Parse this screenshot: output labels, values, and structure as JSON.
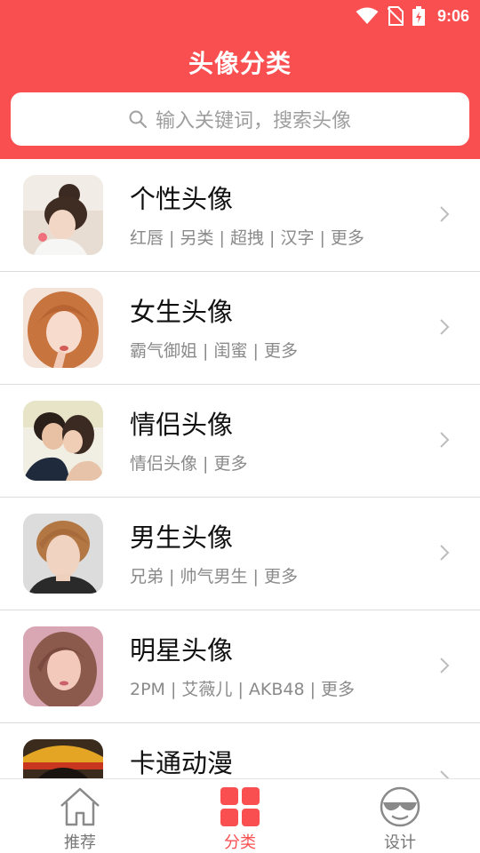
{
  "status": {
    "time": "9:06"
  },
  "header": {
    "title": "头像分类"
  },
  "search": {
    "placeholder": "输入关键词，搜索头像"
  },
  "categories": [
    {
      "title": "个性头像",
      "tags": "红唇 | 另类 | 超拽 | 汉字 | 更多"
    },
    {
      "title": "女生头像",
      "tags": "霸气御姐 | 闺蜜 | 更多"
    },
    {
      "title": "情侣头像",
      "tags": "情侣头像 | 更多"
    },
    {
      "title": "男生头像",
      "tags": "兄弟 | 帅气男生 | 更多"
    },
    {
      "title": "明星头像",
      "tags": "2PM | 艾薇儿 | AKB48 | 更多"
    },
    {
      "title": "卡通动漫",
      "tags": ""
    }
  ],
  "tabs": [
    {
      "label": "推荐",
      "icon": "home-icon"
    },
    {
      "label": "分类",
      "icon": "grid-icon"
    },
    {
      "label": "设计",
      "icon": "face-icon"
    }
  ],
  "colors": {
    "accent": "#f94f51"
  }
}
